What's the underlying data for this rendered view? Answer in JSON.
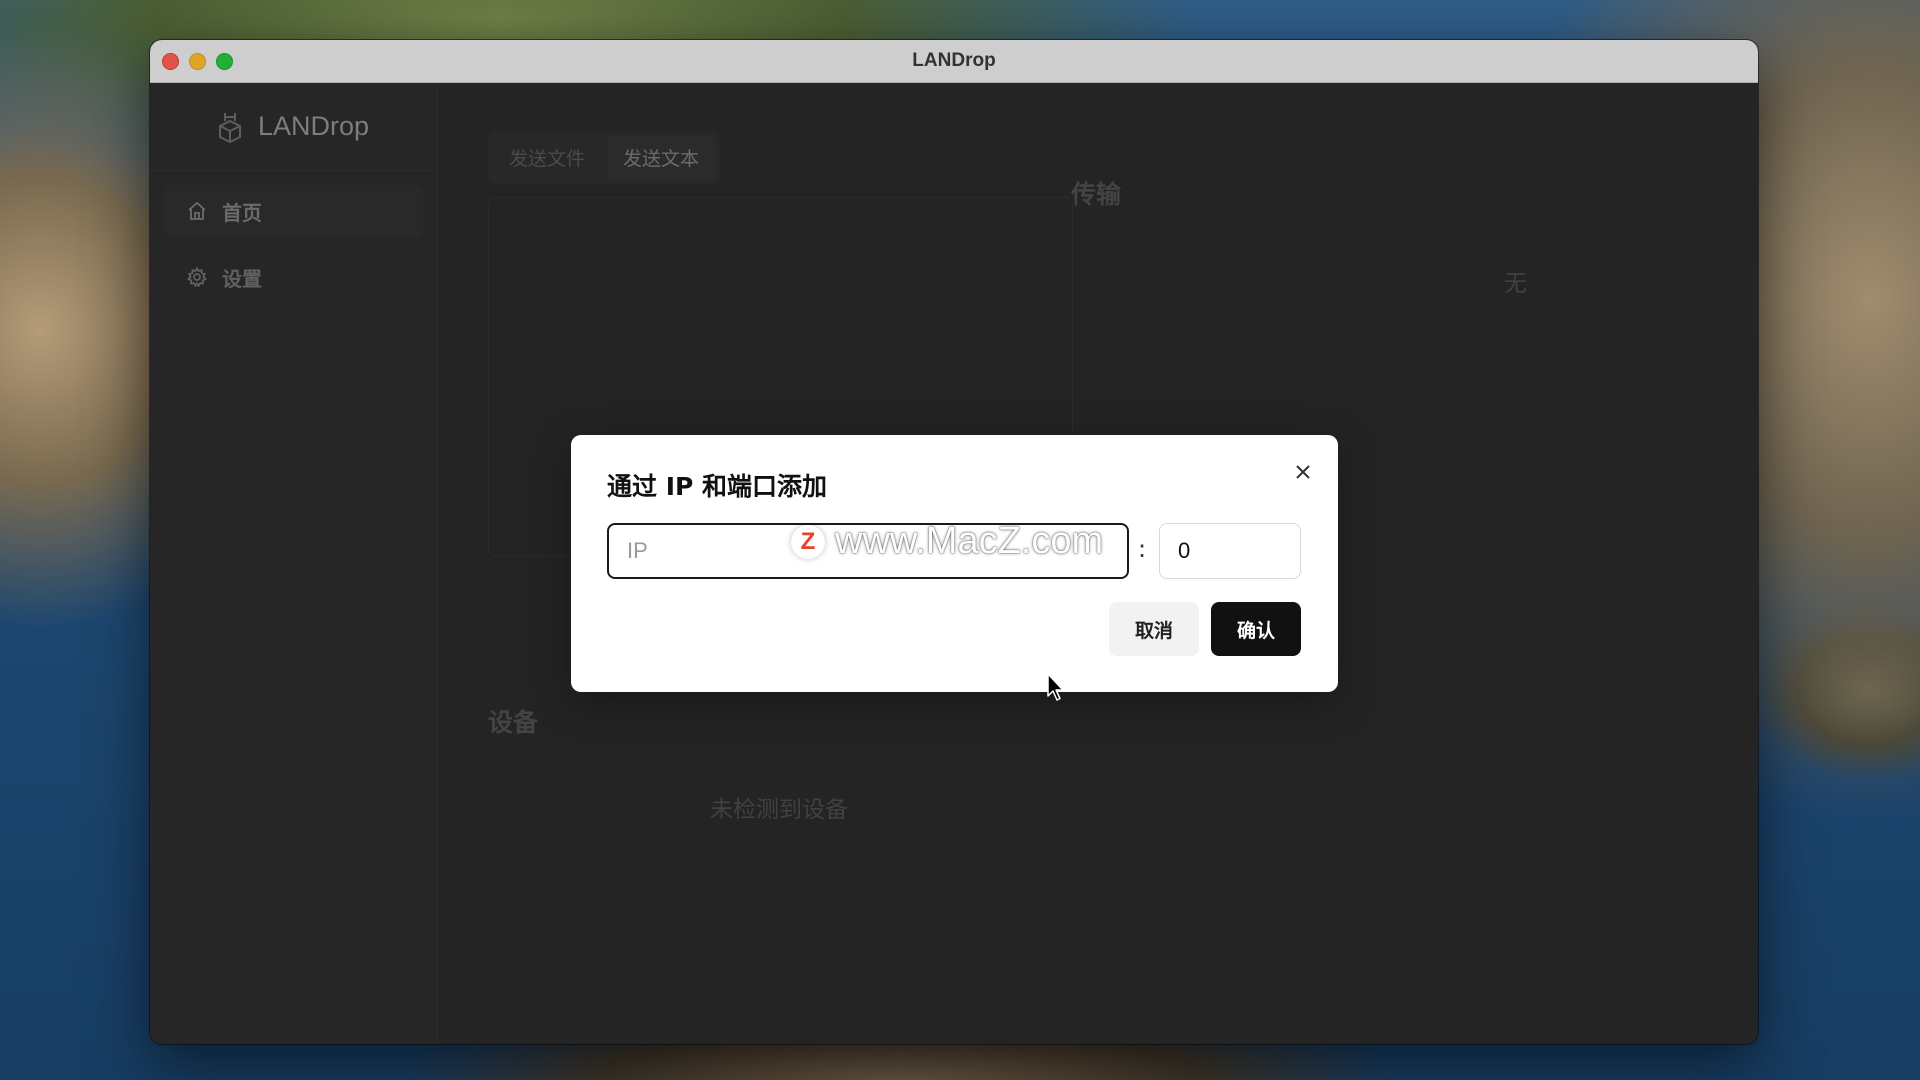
{
  "window": {
    "title": "LANDrop"
  },
  "sidebar": {
    "brand": "LANDrop",
    "items": [
      {
        "label": "首页",
        "icon": "home-icon"
      },
      {
        "label": "设置",
        "icon": "gear-icon"
      }
    ]
  },
  "main": {
    "tabs": [
      {
        "label": "发送文件"
      },
      {
        "label": "发送文本"
      }
    ],
    "transfer": {
      "title": "传输",
      "empty": "无"
    },
    "devices": {
      "title": "设备",
      "empty": "未检测到设备"
    }
  },
  "dialog": {
    "title": "通过 IP 和端口添加",
    "ip_placeholder": "IP",
    "ip_value": "",
    "separator": ":",
    "port_value": "0",
    "cancel_label": "取消",
    "confirm_label": "确认"
  },
  "watermark": {
    "badge": "Z",
    "text": "www.MacZ.com"
  },
  "colors": {
    "accent": "#111111",
    "close_light": "#fe5f57",
    "min_light": "#febc2e",
    "max_light": "#28c840",
    "watermark_badge": "#e8402a"
  }
}
